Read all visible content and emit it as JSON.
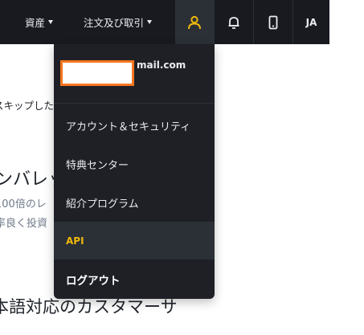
{
  "navbar": {
    "assets_label": "資産",
    "orders_label": "注文及び取引",
    "language_label": "JA"
  },
  "background": {
    "skip_text": "スキップした",
    "leverage_heading": "ンバレッ",
    "line1": "100倍のレ",
    "line2": "率良く投資",
    "support_heading": "本語対応のカスタマーサ"
  },
  "user_menu": {
    "email_visible": "mail.com",
    "items": [
      {
        "label": "アカウント＆セキュリティ"
      },
      {
        "label": "特典センター"
      },
      {
        "label": "紹介プログラム"
      },
      {
        "label": "API"
      },
      {
        "label": "ログアウト"
      }
    ]
  },
  "colors": {
    "navbar_bg": "#181a20",
    "dropdown_bg": "#1e2026",
    "accent": "#f0b90b",
    "redaction_border": "#f7761e"
  },
  "icons": [
    "user-icon",
    "bell-icon",
    "phone-icon"
  ]
}
